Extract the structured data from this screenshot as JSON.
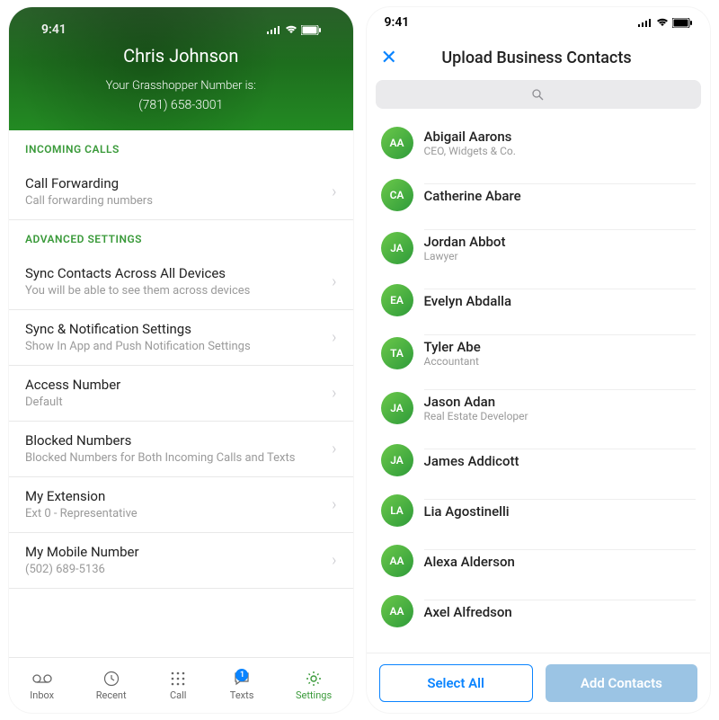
{
  "status": {
    "time": "9:41"
  },
  "left": {
    "header": {
      "name": "Chris Johnson",
      "label": "Your Grasshopper Number is:",
      "number": "(781) 658-3001"
    },
    "sec_incoming": "INCOMING CALLS",
    "sec_advanced": "ADVANCED SETTINGS",
    "rows": {
      "cf": {
        "t": "Call Forwarding",
        "s": "Call forwarding numbers"
      },
      "sync": {
        "t": "Sync Contacts Across All Devices",
        "s": "You will be able to see them across devices"
      },
      "notif": {
        "t": "Sync & Notification Settings",
        "s": "Show In App and Push Notification Settings"
      },
      "acc": {
        "t": "Access Number",
        "s": "Default"
      },
      "blk": {
        "t": "Blocked Numbers",
        "s": "Blocked Numbers for Both Incoming Calls and Texts"
      },
      "ext": {
        "t": "My Extension",
        "s": "Ext 0 - Representative"
      },
      "mob": {
        "t": "My Mobile Number",
        "s": "(502) 689-5136"
      }
    },
    "tabs": {
      "inbox": "Inbox",
      "recent": "Recent",
      "call": "Call",
      "texts": "Texts",
      "texts_badge": "1",
      "settings": "Settings"
    }
  },
  "right": {
    "title": "Upload Business Contacts",
    "contacts": [
      {
        "i": "AA",
        "n": "Abigail Aarons",
        "r": "CEO, Widgets & Co."
      },
      {
        "i": "CA",
        "n": "Catherine Abare",
        "r": ""
      },
      {
        "i": "JA",
        "n": "Jordan Abbot",
        "r": "Lawyer"
      },
      {
        "i": "EA",
        "n": "Evelyn Abdalla",
        "r": ""
      },
      {
        "i": "TA",
        "n": "Tyler Abe",
        "r": "Accountant"
      },
      {
        "i": "JA",
        "n": "Jason Adan",
        "r": "Real Estate Developer"
      },
      {
        "i": "JA",
        "n": "James Addicott",
        "r": ""
      },
      {
        "i": "LA",
        "n": "Lia Agostinelli",
        "r": ""
      },
      {
        "i": "AA",
        "n": "Alexa Alderson",
        "r": ""
      },
      {
        "i": "AA",
        "n": "Axel Alfredson",
        "r": ""
      }
    ],
    "buttons": {
      "select": "Select All",
      "add": "Add Contacts"
    }
  }
}
